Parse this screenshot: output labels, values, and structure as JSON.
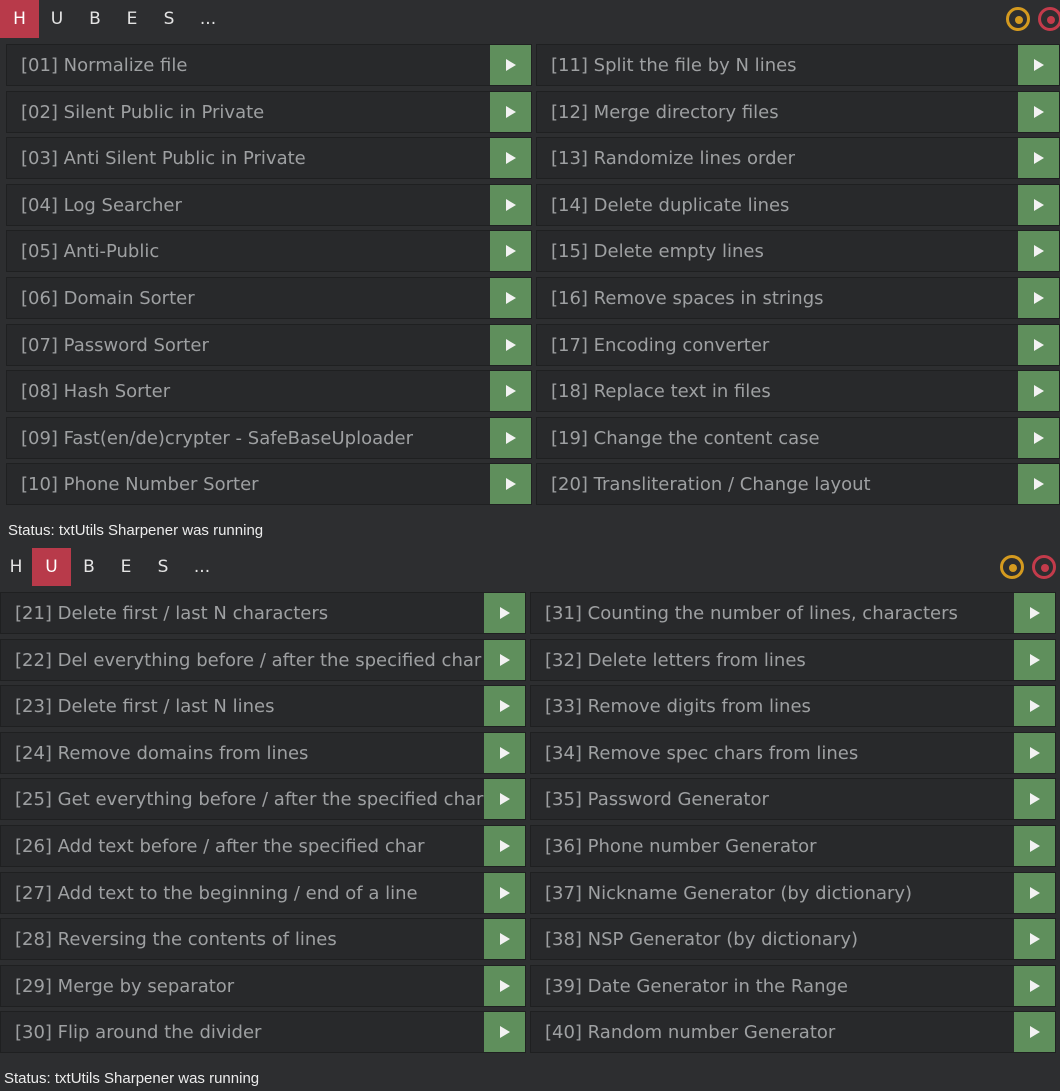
{
  "panels": [
    {
      "tabs": [
        "H",
        "U",
        "B",
        "E",
        "S",
        "..."
      ],
      "active_tab": 0,
      "status": "Status: txtUtils Sharpener was running",
      "left": [
        "[01] Normalize file",
        "[02] Silent Public in Private",
        "[03] Anti Silent Public in Private",
        "[04] Log Searcher",
        "[05] Anti-Public",
        "[06] Domain Sorter",
        "[07] Password Sorter",
        "[08] Hash Sorter",
        "[09] Fast(en/de)crypter - SafeBaseUploader",
        "[10] Phone Number Sorter"
      ],
      "right": [
        "[11] Split the file by N lines",
        "[12] Merge directory files",
        "[13] Randomize lines order",
        "[14] Delete duplicate lines",
        "[15] Delete empty lines",
        "[16] Remove spaces in strings",
        "[17] Encoding converter",
        "[18] Replace text in files",
        "[19] Change the content case",
        "[20] Transliteration / Change layout"
      ]
    },
    {
      "tabs": [
        "H",
        "U",
        "B",
        "E",
        "S",
        "..."
      ],
      "active_tab": 1,
      "status": "Status: txtUtils Sharpener was running",
      "left": [
        "[21] Delete first / last N characters",
        "[22] Del everything before / after the specified char",
        "[23] Delete first / last N lines",
        "[24] Remove domains from lines",
        "[25] Get everything before / after the specified char",
        "[26] Add text before / after the specified char",
        "[27] Add text to the beginning / end of a line",
        "[28] Reversing the contents of lines",
        "[29] Merge by separator",
        "[30] Flip around the divider"
      ],
      "right": [
        "[31] Counting the number of lines, characters",
        "[32] Delete letters from lines",
        "[33] Remove digits from lines",
        "[34] Remove spec chars from lines",
        "[35] Password Generator",
        "[36] Phone number Generator",
        "[37] Nickname Generator (by dictionary)",
        "[38] NSP Generator (by dictionary)",
        "[39] Date Generator in the Range",
        "[40] Random number Generator"
      ]
    }
  ],
  "icons": {
    "minimize": "circle-dot-icon",
    "close": "circle-dot-icon",
    "run": "play-icon"
  },
  "colors": {
    "background": "#2d2e30",
    "active_tab": "#b83a4a",
    "run_button": "#5f8f5c",
    "minimize": "#d49a1f",
    "close": "#c33b4b"
  }
}
